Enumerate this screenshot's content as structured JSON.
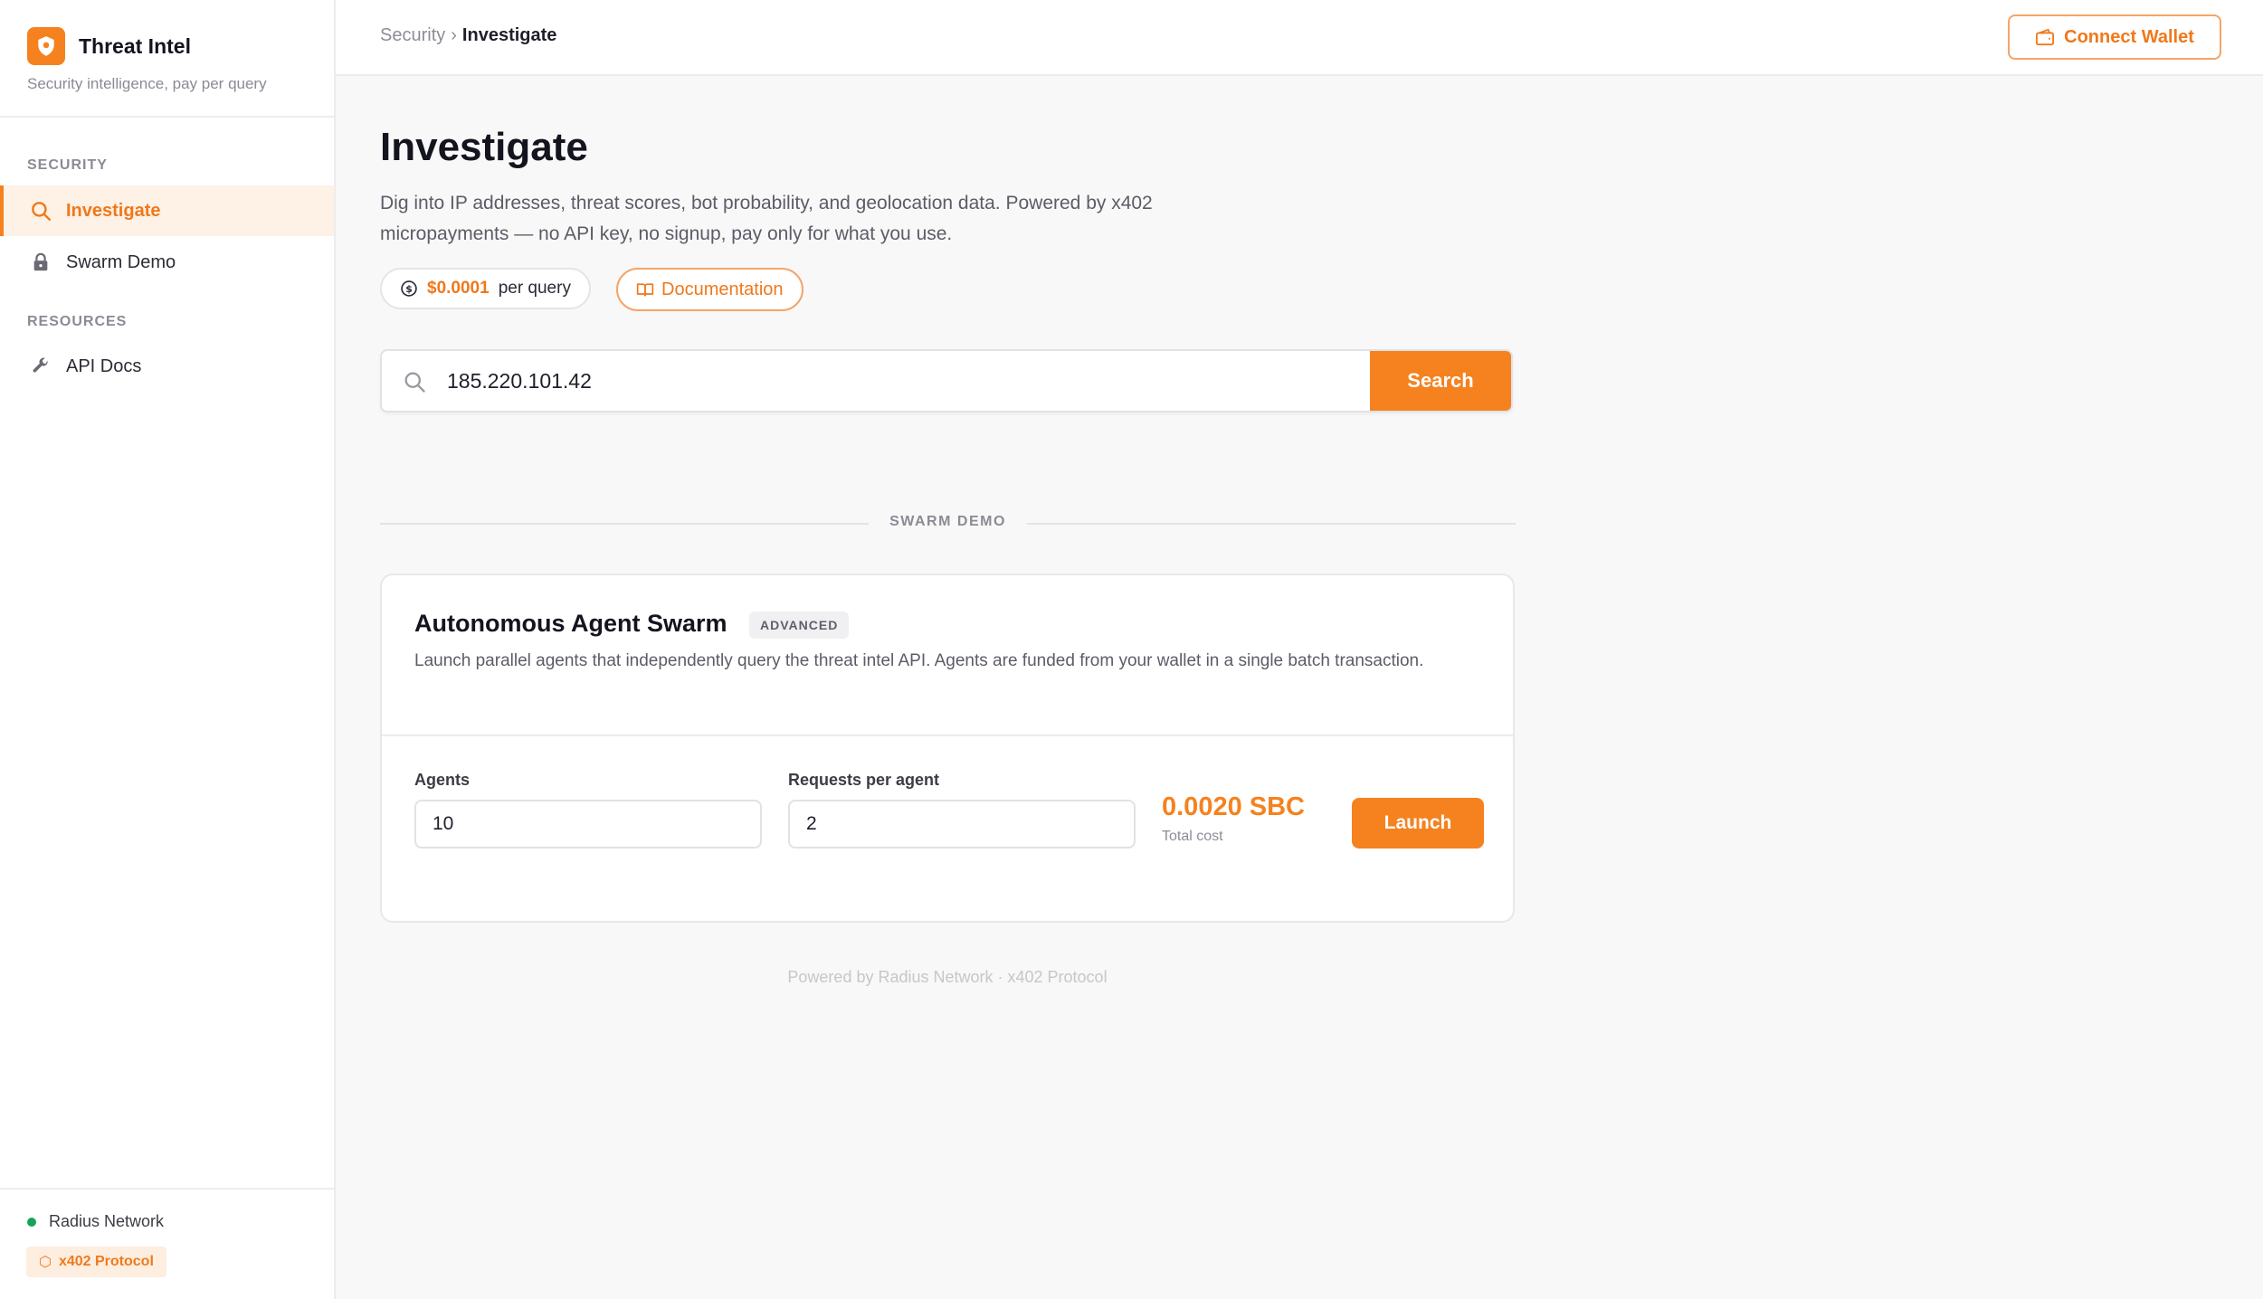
{
  "app": {
    "title": "Threat Intel",
    "subtitle": "Security intelligence, pay per query"
  },
  "sidebar": {
    "sections": [
      {
        "label": "SECURITY"
      },
      {
        "label": "RESOURCES"
      }
    ],
    "items": [
      {
        "label": "Investigate",
        "icon": "search-icon",
        "active": true
      },
      {
        "label": "Swarm Demo",
        "icon": "lock-icon",
        "active": false
      },
      {
        "label": "API Docs",
        "icon": "wrench-icon",
        "active": false
      }
    ],
    "network": "Radius Network",
    "protocol": "x402 Protocol"
  },
  "topbar": {
    "breadcrumb": [
      "Security",
      "Investigate"
    ],
    "breadcrumb_sep": "›",
    "connect_wallet": "Connect Wallet"
  },
  "main": {
    "title": "Investigate",
    "description": "Dig into IP addresses, threat scores, bot probability, and geolocation data. Powered by x402 micropayments — no API key, no signup, pay only for what you use.",
    "price": "$0.0001",
    "price_unit": "per query",
    "docs_label": "Documentation",
    "search": {
      "value": "185.220.101.42",
      "button": "Search"
    },
    "divider_label": "SWARM DEMO",
    "swarm": {
      "title": "Autonomous Agent Swarm",
      "badge": "ADVANCED",
      "description": "Launch parallel agents that independently query the threat intel API. Agents are funded from your wallet in a single batch transaction.",
      "agents_label": "Agents",
      "agents_value": "10",
      "requests_label": "Requests per agent",
      "requests_value": "2",
      "total_cost": "0.0020 SBC",
      "total_cost_label": "Total cost",
      "launch": "Launch"
    },
    "footer": "Powered by Radius Network · x402 Protocol"
  },
  "colors": {
    "accent": "#f5821f",
    "accent_light": "#fef1e5",
    "status_green": "#16a35b"
  }
}
